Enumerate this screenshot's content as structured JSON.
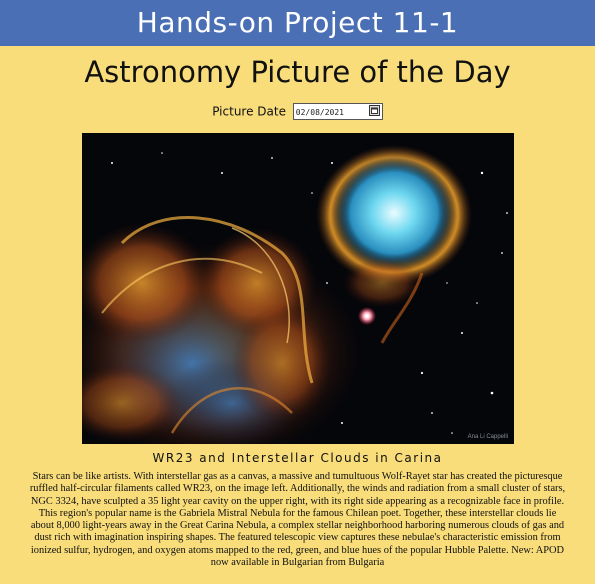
{
  "banner": {
    "title": "Hands-on Project 11-1"
  },
  "page": {
    "title": "Astronomy Picture of the Day"
  },
  "date_picker": {
    "label": "Picture Date",
    "value": "02/08/2021",
    "icon": "calendar-icon"
  },
  "image": {
    "credit": "Ana Li Cappelli"
  },
  "caption": "WR23 and Interstellar Clouds in Carina",
  "description": "Stars can be like artists. With interstellar gas as a canvas, a massive and tumultuous Wolf-Rayet star has created the picturesque ruffled half-circular filaments called WR23, on the image left. Additionally, the winds and radiation from a small cluster of stars, NGC 3324, have sculpted a 35 light year cavity on the upper right, with its right side appearing as a recognizable face in profile. This region's popular name is the Gabriela Mistral Nebula for the famous Chilean poet. Together, these interstellar clouds lie about 8,000 light-years away in the Great Carina Nebula, a complex stellar neighborhood harboring numerous clouds of gas and dust rich with imagination inspiring shapes. The featured telescopic view captures these nebulae's characteristic emission from ionized sulfur, hydrogen, and oxygen atoms mapped to the red, green, and blue hues of the popular Hubble Palette. New: APOD now available in Bulgarian from Bulgaria",
  "colors": {
    "banner_bg": "#4a6fb5",
    "page_bg": "#f8dd7a"
  }
}
